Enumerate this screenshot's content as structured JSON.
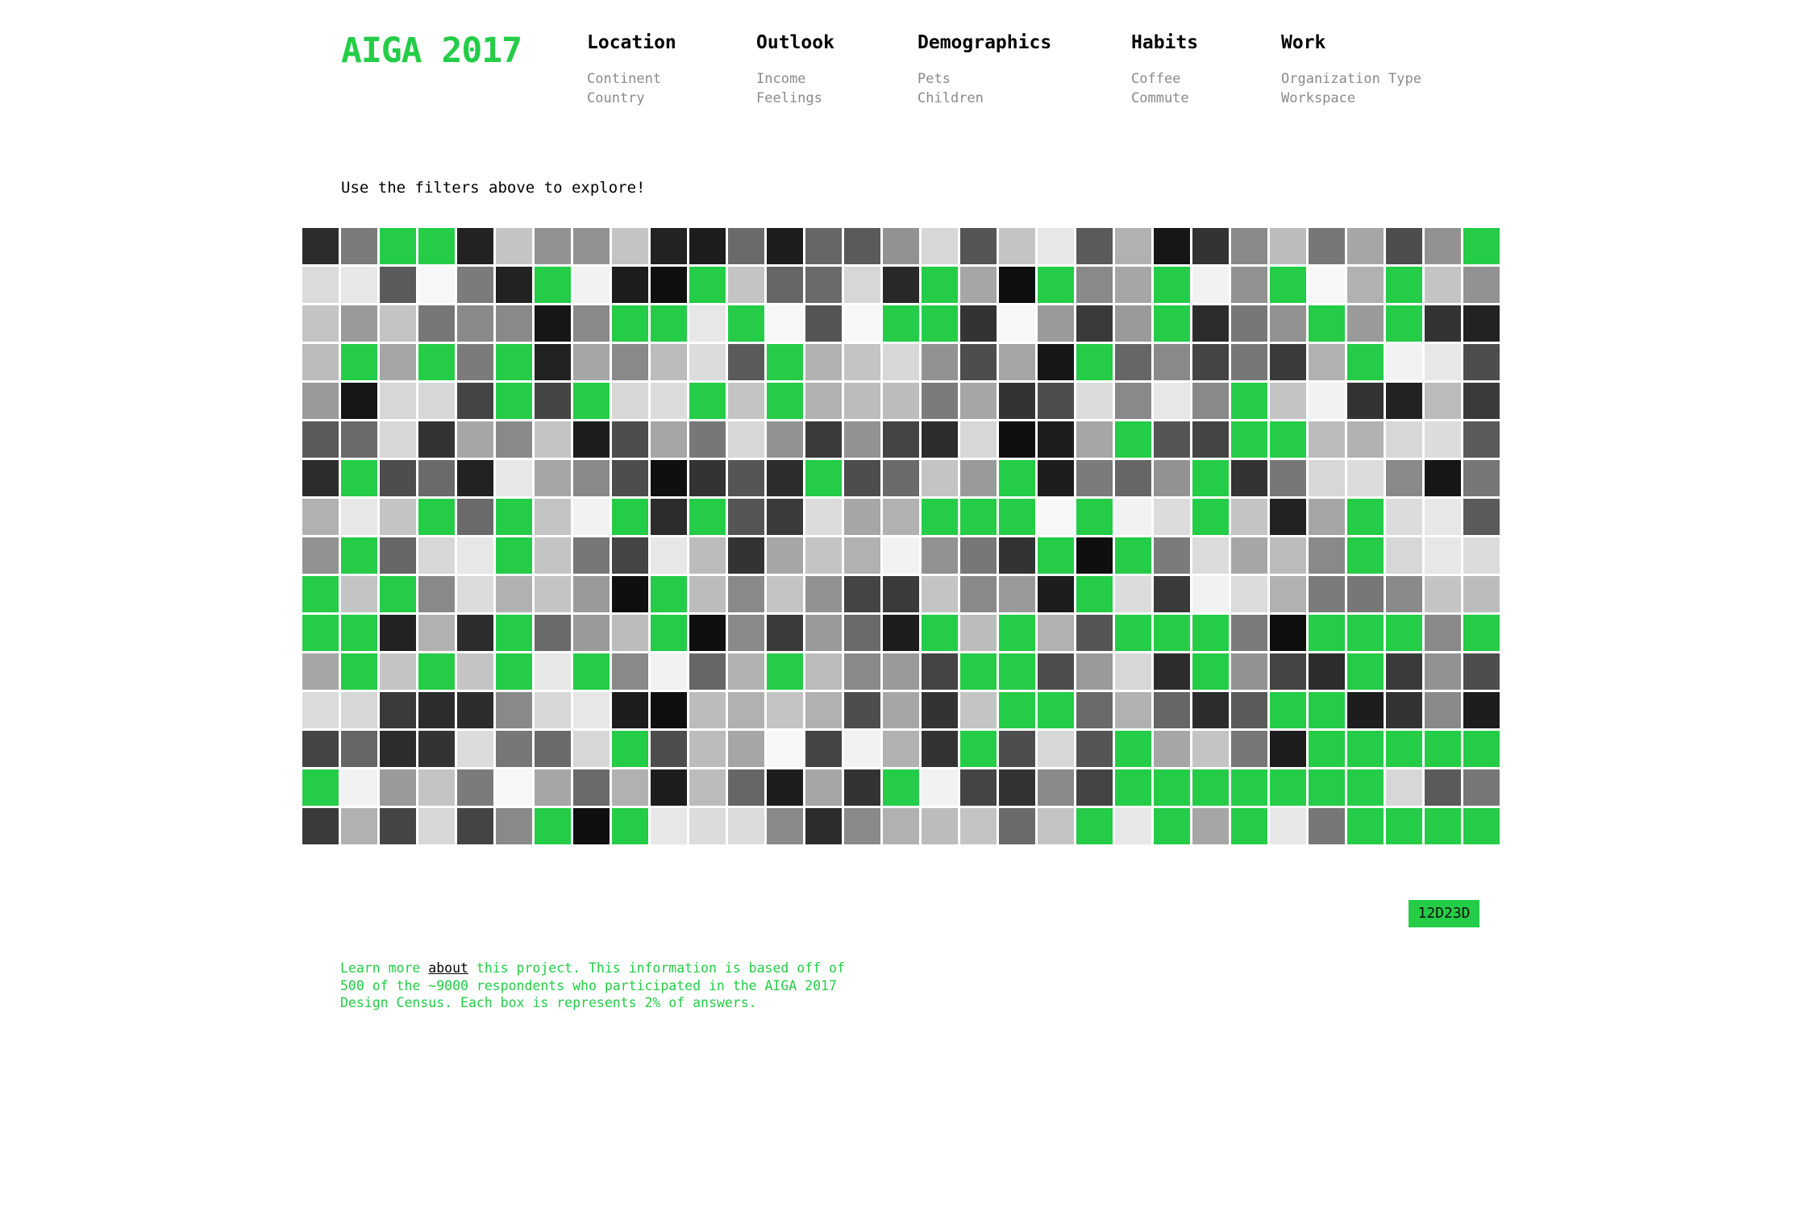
{
  "logo": "AIGA 2017",
  "nav": [
    {
      "title": "Location",
      "items": [
        "Continent",
        "Country"
      ]
    },
    {
      "title": "Outlook",
      "items": [
        "Income",
        "Feelings"
      ]
    },
    {
      "title": "Demographics",
      "items": [
        "Pets",
        "Children"
      ]
    },
    {
      "title": "Habits",
      "items": [
        "Coffee",
        "Commute"
      ]
    },
    {
      "title": "Work",
      "items": [
        "Organization Type",
        "Workspace"
      ]
    }
  ],
  "prompt": "Use the filters above to explore!",
  "grid": {
    "columns": 31,
    "rows": 16,
    "accent_color": "#25cc47",
    "cells": [
      [
        "#2c2c2c",
        "#7b7b7b",
        "#25cc47",
        "#25cc47",
        "#222222",
        "#c4c4c4",
        "#929292",
        "#929292",
        "#c4c4c4",
        "#222222",
        "#1d1d1d",
        "#6a6a6a",
        "#1d1d1d",
        "#666666",
        "#5a5a5a",
        "#929292",
        "#d7d7d7",
        "#555555",
        "#c4c4c4",
        "#e7e7e7",
        "#5a5a5a",
        "#b1b1b1",
        "#161616",
        "#333333",
        "#898989",
        "#bcbcbc",
        "#777777",
        "#a6a6a6",
        "#4d4d4d",
        "#929292",
        "#25cc47"
      ],
      [
        "#dcdcdc",
        "#e7e7e7",
        "#5a5a5a",
        "#f7f7f7",
        "#7b7b7b",
        "#222222",
        "#25cc47",
        "#f2f2f2",
        "#1d1d1d",
        "#0f0f0f",
        "#25cc47",
        "#c4c4c4",
        "#666666",
        "#6a6a6a",
        "#d7d7d7",
        "#292929",
        "#25cc47",
        "#a6a6a6",
        "#0f0f0f",
        "#25cc47",
        "#898989",
        "#a6a6a6",
        "#25cc47",
        "#f2f2f2",
        "#929292",
        "#25cc47",
        "#f7f7f7",
        "#b1b1b1",
        "#25cc47",
        "#c4c4c4",
        "#929292"
      ],
      [
        "#c4c4c4",
        "#9a9a9a",
        "#c4c4c4",
        "#777777",
        "#898989",
        "#898989",
        "#161616",
        "#898989",
        "#25cc47",
        "#25cc47",
        "#e7e7e7",
        "#25cc47",
        "#f7f7f7",
        "#555555",
        "#f7f7f7",
        "#25cc47",
        "#25cc47",
        "#333333",
        "#f7f7f7",
        "#9a9a9a",
        "#3a3a3a",
        "#9a9a9a",
        "#25cc47",
        "#2c2c2c",
        "#777777",
        "#929292",
        "#25cc47",
        "#9a9a9a",
        "#25cc47",
        "#333333",
        "#222222"
      ],
      [
        "#bcbcbc",
        "#25cc47",
        "#a6a6a6",
        "#25cc47",
        "#7b7b7b",
        "#25cc47",
        "#222222",
        "#a6a6a6",
        "#898989",
        "#bcbcbc",
        "#dcdcdc",
        "#5a5a5a",
        "#25cc47",
        "#b1b1b1",
        "#c4c4c4",
        "#d7d7d7",
        "#929292",
        "#4d4d4d",
        "#a6a6a6",
        "#161616",
        "#25cc47",
        "#666666",
        "#898989",
        "#444444",
        "#777777",
        "#3a3a3a",
        "#b1b1b1",
        "#25cc47",
        "#f2f2f2",
        "#e7e7e7",
        "#4d4d4d"
      ],
      [
        "#9a9a9a",
        "#161616",
        "#d7d7d7",
        "#d7d7d7",
        "#444444",
        "#25cc47",
        "#444444",
        "#25cc47",
        "#d7d7d7",
        "#dcdcdc",
        "#25cc47",
        "#c4c4c4",
        "#25cc47",
        "#b1b1b1",
        "#bcbcbc",
        "#bcbcbc",
        "#7b7b7b",
        "#a6a6a6",
        "#333333",
        "#4d4d4d",
        "#dcdcdc",
        "#898989",
        "#e7e7e7",
        "#898989",
        "#25cc47",
        "#c4c4c4",
        "#f2f2f2",
        "#333333",
        "#222222",
        "#bcbcbc",
        "#3a3a3a"
      ],
      [
        "#5a5a5a",
        "#6a6a6a",
        "#d7d7d7",
        "#333333",
        "#a6a6a6",
        "#898989",
        "#c4c4c4",
        "#1d1d1d",
        "#4d4d4d",
        "#a6a6a6",
        "#777777",
        "#d7d7d7",
        "#929292",
        "#3a3a3a",
        "#929292",
        "#444444",
        "#2c2c2c",
        "#d7d7d7",
        "#0f0f0f",
        "#1d1d1d",
        "#a6a6a6",
        "#25cc47",
        "#555555",
        "#444444",
        "#25cc47",
        "#25cc47",
        "#bcbcbc",
        "#b1b1b1",
        "#d7d7d7",
        "#dcdcdc",
        "#5a5a5a"
      ],
      [
        "#2c2c2c",
        "#25cc47",
        "#4d4d4d",
        "#6a6a6a",
        "#222222",
        "#e7e7e7",
        "#a6a6a6",
        "#898989",
        "#4d4d4d",
        "#0f0f0f",
        "#333333",
        "#555555",
        "#2c2c2c",
        "#25cc47",
        "#4d4d4d",
        "#6a6a6a",
        "#c4c4c4",
        "#9a9a9a",
        "#25cc47",
        "#1d1d1d",
        "#7b7b7b",
        "#666666",
        "#929292",
        "#25cc47",
        "#333333",
        "#777777",
        "#d7d7d7",
        "#dcdcdc",
        "#898989",
        "#161616",
        "#777777"
      ],
      [
        "#b1b1b1",
        "#e7e7e7",
        "#c4c4c4",
        "#25cc47",
        "#6a6a6a",
        "#25cc47",
        "#c4c4c4",
        "#f2f2f2",
        "#25cc47",
        "#2c2c2c",
        "#25cc47",
        "#555555",
        "#3a3a3a",
        "#dcdcdc",
        "#a6a6a6",
        "#b1b1b1",
        "#25cc47",
        "#25cc47",
        "#25cc47",
        "#f7f7f7",
        "#25cc47",
        "#f2f2f2",
        "#dcdcdc",
        "#25cc47",
        "#c4c4c4",
        "#222222",
        "#a6a6a6",
        "#25cc47",
        "#dcdcdc",
        "#e7e7e7",
        "#5a5a5a"
      ],
      [
        "#929292",
        "#25cc47",
        "#666666",
        "#d7d7d7",
        "#e7e7e7",
        "#25cc47",
        "#c4c4c4",
        "#777777",
        "#444444",
        "#e7e7e7",
        "#bcbcbc",
        "#333333",
        "#a6a6a6",
        "#c4c4c4",
        "#b1b1b1",
        "#f2f2f2",
        "#929292",
        "#777777",
        "#333333",
        "#25cc47",
        "#0f0f0f",
        "#25cc47",
        "#7b7b7b",
        "#dcdcdc",
        "#a6a6a6",
        "#bcbcbc",
        "#898989",
        "#25cc47",
        "#d7d7d7",
        "#e7e7e7",
        "#dcdcdc"
      ],
      [
        "#25cc47",
        "#c4c4c4",
        "#25cc47",
        "#898989",
        "#dcdcdc",
        "#b1b1b1",
        "#c4c4c4",
        "#9a9a9a",
        "#0f0f0f",
        "#25cc47",
        "#bcbcbc",
        "#898989",
        "#c4c4c4",
        "#929292",
        "#444444",
        "#3a3a3a",
        "#c4c4c4",
        "#898989",
        "#9a9a9a",
        "#1d1d1d",
        "#25cc47",
        "#dcdcdc",
        "#3a3a3a",
        "#f2f2f2",
        "#dcdcdc",
        "#b1b1b1",
        "#7b7b7b",
        "#777777",
        "#898989",
        "#c4c4c4",
        "#bcbcbc"
      ],
      [
        "#25cc47",
        "#25cc47",
        "#222222",
        "#b1b1b1",
        "#2c2c2c",
        "#25cc47",
        "#6a6a6a",
        "#9a9a9a",
        "#bcbcbc",
        "#25cc47",
        "#0f0f0f",
        "#898989",
        "#3a3a3a",
        "#9a9a9a",
        "#6a6a6a",
        "#1d1d1d",
        "#25cc47",
        "#bcbcbc",
        "#25cc47",
        "#b1b1b1",
        "#555555",
        "#25cc47",
        "#25cc47",
        "#25cc47",
        "#7b7b7b",
        "#0f0f0f",
        "#25cc47",
        "#25cc47",
        "#25cc47",
        "#898989",
        "#25cc47"
      ],
      [
        "#a6a6a6",
        "#25cc47",
        "#c4c4c4",
        "#25cc47",
        "#c4c4c4",
        "#25cc47",
        "#e7e7e7",
        "#25cc47",
        "#898989",
        "#f2f2f2",
        "#666666",
        "#b1b1b1",
        "#25cc47",
        "#bcbcbc",
        "#898989",
        "#9a9a9a",
        "#444444",
        "#25cc47",
        "#25cc47",
        "#4d4d4d",
        "#9a9a9a",
        "#d7d7d7",
        "#2c2c2c",
        "#25cc47",
        "#929292",
        "#444444",
        "#2c2c2c",
        "#25cc47",
        "#3a3a3a",
        "#929292",
        "#4d4d4d"
      ],
      [
        "#dcdcdc",
        "#d7d7d7",
        "#3a3a3a",
        "#2c2c2c",
        "#2c2c2c",
        "#898989",
        "#d7d7d7",
        "#e7e7e7",
        "#1d1d1d",
        "#0f0f0f",
        "#bcbcbc",
        "#b1b1b1",
        "#c4c4c4",
        "#b1b1b1",
        "#4d4d4d",
        "#a6a6a6",
        "#333333",
        "#c4c4c4",
        "#25cc47",
        "#25cc47",
        "#6a6a6a",
        "#b1b1b1",
        "#666666",
        "#2c2c2c",
        "#5a5a5a",
        "#25cc47",
        "#25cc47",
        "#1d1d1d",
        "#333333",
        "#898989",
        "#1d1d1d"
      ],
      [
        "#444444",
        "#666666",
        "#2c2c2c",
        "#333333",
        "#dcdcdc",
        "#777777",
        "#6a6a6a",
        "#d7d7d7",
        "#25cc47",
        "#4d4d4d",
        "#bcbcbc",
        "#a6a6a6",
        "#f7f7f7",
        "#444444",
        "#f2f2f2",
        "#b1b1b1",
        "#333333",
        "#25cc47",
        "#4d4d4d",
        "#d7d7d7",
        "#555555",
        "#25cc47",
        "#a6a6a6",
        "#c4c4c4",
        "#777777",
        "#1d1d1d",
        "#25cc47",
        "#25cc47",
        "#25cc47",
        "#25cc47",
        "#25cc47"
      ],
      [
        "#25cc47",
        "#f2f2f2",
        "#9a9a9a",
        "#c4c4c4",
        "#7b7b7b",
        "#f7f7f7",
        "#a6a6a6",
        "#6a6a6a",
        "#b1b1b1",
        "#1d1d1d",
        "#bcbcbc",
        "#666666",
        "#1d1d1d",
        "#a6a6a6",
        "#333333",
        "#25cc47",
        "#f2f2f2",
        "#444444",
        "#333333",
        "#898989",
        "#444444",
        "#25cc47",
        "#25cc47",
        "#25cc47",
        "#25cc47",
        "#25cc47",
        "#25cc47",
        "#25cc47",
        "#d7d7d7",
        "#5a5a5a",
        "#777777"
      ],
      [
        "#3a3a3a",
        "#b1b1b1",
        "#444444",
        "#d7d7d7",
        "#444444",
        "#898989",
        "#25cc47",
        "#0f0f0f",
        "#25cc47",
        "#e7e7e7",
        "#dcdcdc",
        "#dcdcdc",
        "#898989",
        "#2c2c2c",
        "#898989",
        "#b1b1b1",
        "#bcbcbc",
        "#c4c4c4",
        "#6a6a6a",
        "#c4c4c4",
        "#25cc47",
        "#e7e7e7",
        "#25cc47",
        "#a6a6a6",
        "#25cc47",
        "#e7e7e7",
        "#777777",
        "#25cc47",
        "#25cc47",
        "#25cc47",
        "#25cc47"
      ]
    ]
  },
  "hex_badge": "12D23D",
  "info": {
    "before": "Learn more ",
    "link": "about",
    "after": " this project. This information is based off of 500 of the ~9000 respondents who participated in the AIGA 2017 Design Census. Each box is represents 2% of answers."
  }
}
